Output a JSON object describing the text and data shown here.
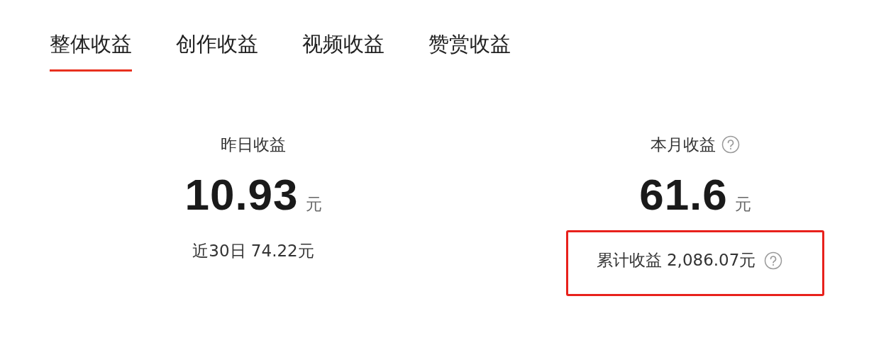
{
  "tabs": [
    {
      "label": "整体收益",
      "selected": true
    },
    {
      "label": "创作收益",
      "selected": false
    },
    {
      "label": "视频收益",
      "selected": false
    },
    {
      "label": "赞赏收益",
      "selected": false
    }
  ],
  "stats": [
    {
      "label": "昨日收益",
      "help": false,
      "value": "10.93",
      "unit": "元",
      "footer": "近30日 74.22元",
      "footer_help": false,
      "highlighted": false
    },
    {
      "label": "本月收益",
      "help": true,
      "value": "61.6",
      "unit": "元",
      "footer": "累计收益 2,086.07元",
      "footer_help": true,
      "highlighted": true
    }
  ]
}
